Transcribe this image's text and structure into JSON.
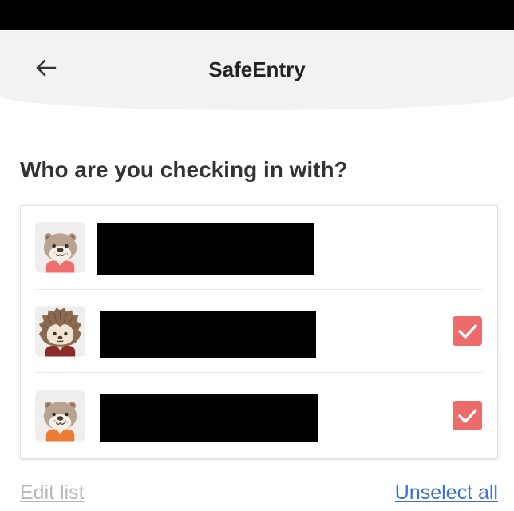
{
  "header": {
    "title": "SafeEntry",
    "back_icon": "arrow-left-icon"
  },
  "main": {
    "question": "Who are you checking in with?",
    "people": [
      {
        "avatar": "otter-avatar-icon",
        "has_checkbox": false,
        "checked": false
      },
      {
        "avatar": "hedgehog-avatar-icon",
        "has_checkbox": true,
        "checked": true
      },
      {
        "avatar": "otter-avatar-icon",
        "has_checkbox": true,
        "checked": true
      }
    ],
    "check_icon": "check-icon"
  },
  "footer": {
    "edit_list_label": "Edit list",
    "unselect_all_label": "Unselect all"
  },
  "colors": {
    "status_bar": "#000000",
    "header_background": "#f2f2f2",
    "checkbox": "#ee6b6b",
    "link": "#3d70cf",
    "disabled_link": "#b8b8b8"
  }
}
